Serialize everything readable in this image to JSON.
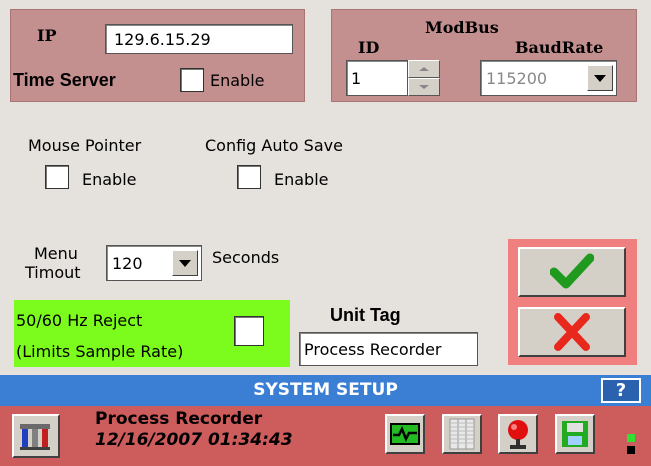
{
  "network": {
    "ip_label": "IP",
    "ip_value": "129.6.15.29",
    "time_server_label": "Time Server",
    "time_server_enable_label": "Enable"
  },
  "modbus": {
    "title": "ModBus",
    "id_label": "ID",
    "id_value": "1",
    "baud_label": "BaudRate",
    "baud_value": "115200"
  },
  "options": {
    "mouse_pointer_label": "Mouse Pointer",
    "mouse_pointer_enable": "Enable",
    "config_autosave_label": "Config Auto Save",
    "config_autosave_enable": "Enable"
  },
  "menu_timeout": {
    "label_line1": "Menu",
    "label_line2": "Timout",
    "value": "120",
    "unit": "Seconds"
  },
  "hz_reject": {
    "line1": "50/60 Hz Reject",
    "line2": "(Limits Sample Rate)"
  },
  "unit_tag": {
    "label": "Unit Tag",
    "value": "Process Recorder"
  },
  "title_bar": {
    "title": "SYSTEM SETUP",
    "help_label": "?"
  },
  "status_bar": {
    "name": "Process Recorder",
    "datetime": "12/16/2007 01:34:43"
  },
  "colors": {
    "panel_rose": "#c48f8f",
    "green_panel": "#7cfc1c",
    "title_blue": "#3b7fd4",
    "status_red": "#cd5c5c",
    "okcancel_pink": "#f08080",
    "ok_green": "#1f9a1f",
    "cancel_red": "#e8281c"
  },
  "icons": {
    "ok": "check-icon",
    "cancel": "x-icon",
    "settings": "tools-icon",
    "trend": "trend-icon",
    "table": "table-icon",
    "alarm": "alarm-icon",
    "save": "save-icon"
  }
}
